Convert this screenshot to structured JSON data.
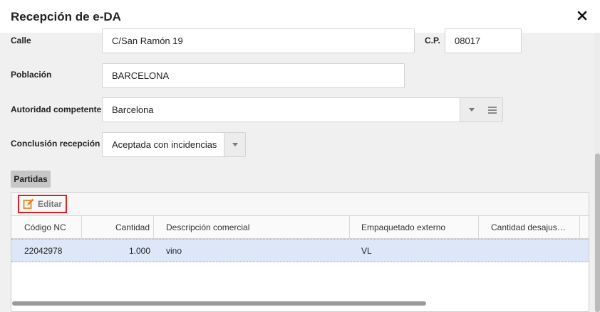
{
  "dialog": {
    "title": "Recepción de e-DA"
  },
  "form": {
    "calle": {
      "label": "Calle",
      "value": "C/San Ramón 19"
    },
    "cp": {
      "label": "C.P.",
      "value": "08017"
    },
    "poblacion": {
      "label": "Población",
      "value": "BARCELONA"
    },
    "autoridad": {
      "label": "Autoridad competente",
      "value": "Barcelona"
    },
    "conclusion": {
      "label": "Conclusión recepción",
      "value": "Aceptada con incidencias"
    }
  },
  "partidas": {
    "tab_label": "Partidas",
    "toolbar": {
      "edit_label": "Editar",
      "edit_icon": "edit-icon"
    },
    "columns": [
      "Código NC",
      "Cantidad",
      "Descripción comercial",
      "Empaquetado externo",
      "Cantidad desajus…"
    ],
    "rows": [
      {
        "codigo_nc": "22042978",
        "cantidad": "1.000",
        "descripcion": "vino",
        "empaquetado": "VL",
        "cantidad_desajuste": ""
      }
    ]
  },
  "colors": {
    "selected_row": "#dde7f7",
    "edit_highlight": "#e02020",
    "edit_icon": "#e8862a"
  }
}
